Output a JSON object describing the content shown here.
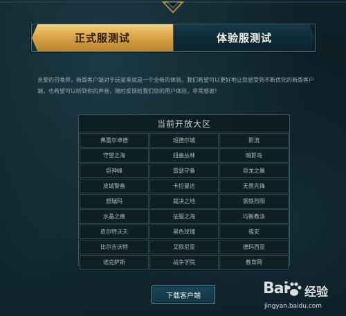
{
  "tabs": {
    "formal_label": "正式服测试",
    "test_label": "体验服测试"
  },
  "intro": {
    "text": "亲爱的召唤师，新版客户端对于玩家来说是一个全新的体验。我们希望可以更好地让您感受到不断优化的新版客户端，也希望可以听到你的声音，随时反馈给我们您的用户体验，非常感谢！"
  },
  "regions": {
    "title": "当前开放大区",
    "cells": [
      "弗雷尔卓德",
      "班德尔城",
      "影流",
      "守望之海",
      "扭曲丛林",
      "暗影岛",
      "巨神峰",
      "雷瑟守备",
      "巨龙之巢",
      "皮城警备",
      "卡拉曼达",
      "无畏先锋",
      "怒瑞玛",
      "裁决之地",
      "钢铁烈阳",
      "水晶之痕",
      "征服之海",
      "均衡教派",
      "皮尔特沃夫",
      "黑色玫瑰",
      "祖安",
      "比尔吉沃特",
      "艾欧尼亚",
      "德玛西亚",
      "诺克萨斯",
      "战争学院",
      "教育网"
    ]
  },
  "download": {
    "label": "下载客户端"
  },
  "watermark": {
    "logo_left": "Bai",
    "logo_right": "经验",
    "url": "jingyan.baidu.com"
  },
  "colors": {
    "accent_gold": "#d9a549",
    "accent_teal": "#3c6f7a",
    "background": "#0b1c22"
  }
}
